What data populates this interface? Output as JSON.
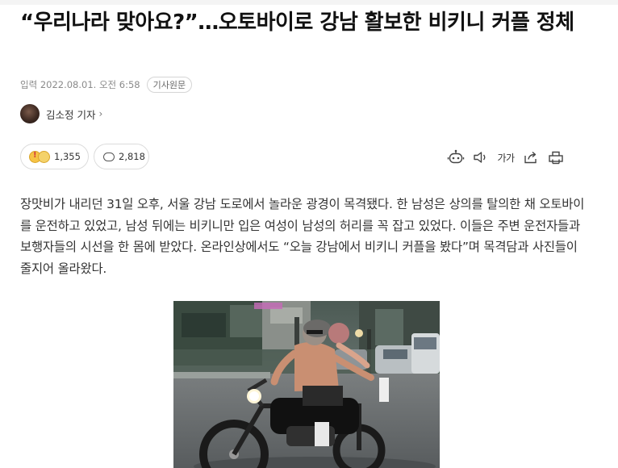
{
  "article": {
    "title": "“우리나라 맞아요?”…오토바이로 강남 활보한 비키니 커플 정체",
    "published": "입력 2022.08.01. 오전 6:58",
    "original_link_label": "기사원문",
    "reporter": "김소정 기자",
    "reporter_chevron": "›"
  },
  "engagement": {
    "reaction_count": "1,355",
    "comment_count": "2,818"
  },
  "toolbar": {
    "font_size_label": "가가",
    "icons": [
      "summary-bot-icon",
      "speaker-icon",
      "font-size-icon",
      "share-icon",
      "print-icon"
    ]
  },
  "body": {
    "paragraph": "장맛비가 내리던 31일 오후, 서울 강남 도로에서 놀라운 광경이 목격됐다. 한 남성은 상의를 탈의한 채 오토바이를 운전하고 있었고, 남성 뒤에는 비키니만 입은 여성이 남성의 허리를 꼭 잡고 있었다. 이들은 주변 운전자들과 보행자들의 시선을 한 몸에 받았다. 온라인상에서도 “오늘 강남에서 비키니 커플을 봤다”며 목격담과 사진들이 줄지어 올라왔다."
  },
  "colors": {
    "title": "#111111",
    "meta": "#8a8a8a",
    "body_text": "#333333",
    "pill_border": "#dcdcdc"
  }
}
